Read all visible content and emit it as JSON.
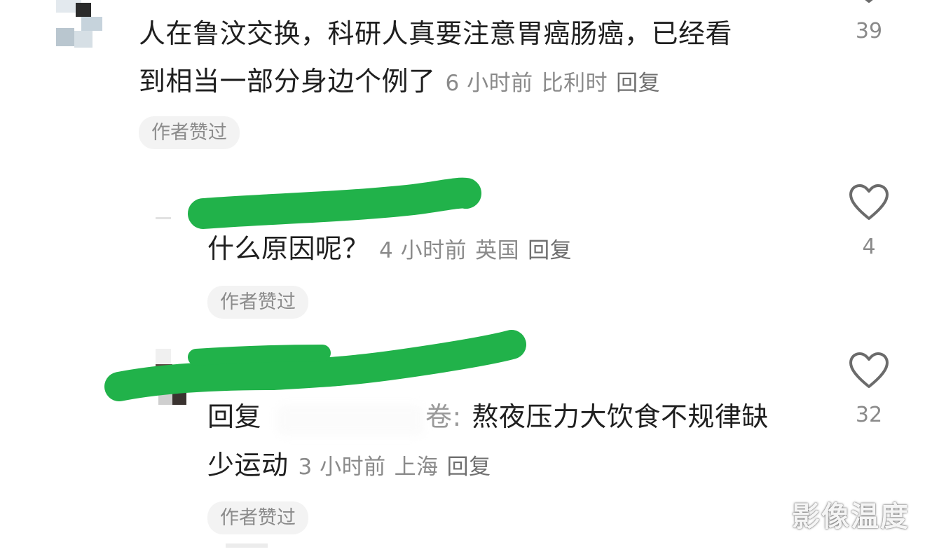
{
  "comments": [
    {
      "line1": "人在鲁汶交换，科研人真要注意胃癌肠癌，已经看",
      "line2": "到相当一部分身边个例了",
      "time": "6 小时前",
      "location": "比利时",
      "reply_label": "回复",
      "badge": "作者赞过",
      "like_count": "39"
    },
    {
      "line1": "什么原因呢？",
      "time": "4 小时前",
      "location": "英国",
      "reply_label": "回复",
      "badge": "作者赞过",
      "like_count": "4"
    },
    {
      "reply_prefix": "回复",
      "reply_target_tail": "卷:",
      "line1_rest": "熬夜压力大饮食不规律缺",
      "line2": "少运动",
      "time": "3 小时前",
      "location": "上海",
      "reply_label": "回复",
      "badge": "作者赞过",
      "like_count": "32"
    }
  ],
  "watermark": "影像温度",
  "colors": {
    "redaction_green": "#21b24a",
    "meta_gray": "#8a8a8a",
    "badge_bg": "#f3f3f3",
    "heart_stroke": "#6b6b6b"
  },
  "icons": {
    "like": "heart-outline-icon"
  }
}
